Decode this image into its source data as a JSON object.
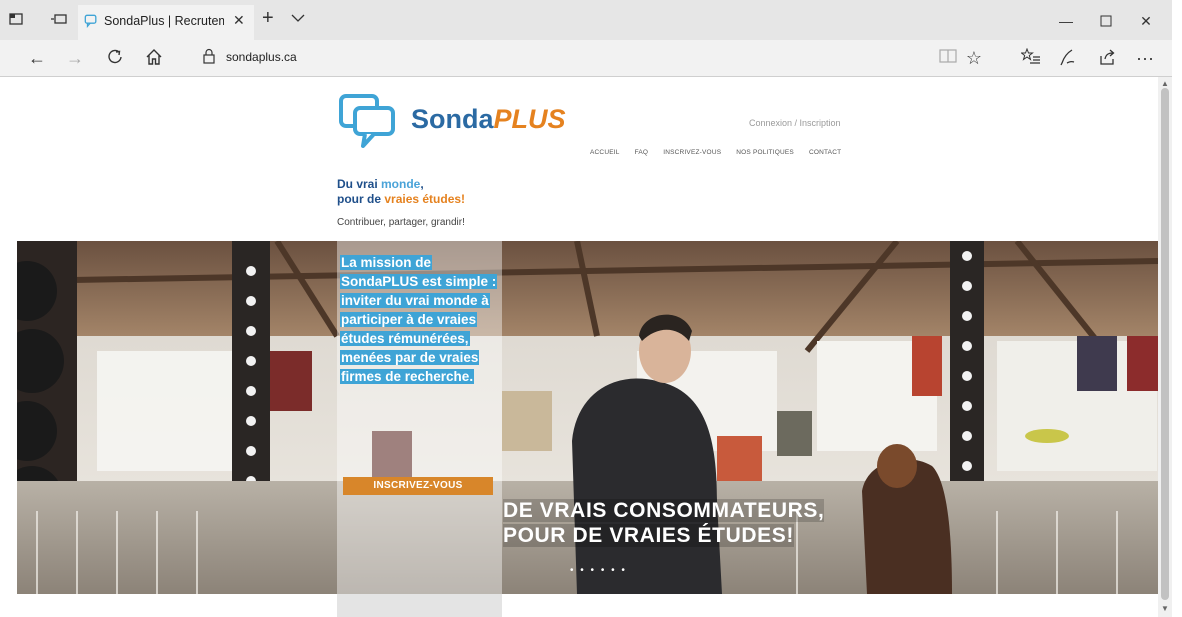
{
  "browser": {
    "tab_title": "SondaPlus | Recrutemer",
    "url": "sondaplus.ca"
  },
  "icons": [
    "tab-actions-icon",
    "tab-preview-icon",
    "tab-favicon",
    "close-icon",
    "new-tab-icon",
    "tab-list-icon",
    "minimize-icon",
    "maximize-icon",
    "close-window-icon",
    "back-icon",
    "forward-icon",
    "refresh-icon",
    "home-icon",
    "lock-icon",
    "reading-view-icon",
    "favorite-star-icon",
    "favorites-hub-icon",
    "pen-icon",
    "share-icon",
    "more-icon",
    "sondaplus-logo-icon"
  ],
  "colors": {
    "brand_blue": "#2b6aa3",
    "brand_orange": "#e5821f",
    "highlight_blue": "#3fa4d6",
    "button_orange": "#d8862a"
  },
  "site": {
    "logo_main": "Sonda",
    "logo_plus": "PLUS",
    "login_link": "Connexion / Inscription",
    "nav": [
      "ACCUEIL",
      "FAQ",
      "INSCRIVEZ-VOUS",
      "NOS POLITIQUES",
      "CONTACT"
    ],
    "tagline_a": "Du vrai ",
    "tagline_b": "monde",
    "tagline_c": ",",
    "tagline_d": "pour de ",
    "tagline_e": "vraies études!",
    "tagline_sub": "Contribuer, partager, grandir!"
  },
  "hero": {
    "mission": "La mission de SondaPLUS est simple : inviter du vrai monde à participer à de vraies études rémunérées, menées par de vraies firmes de recherche.",
    "signup_button": "INSCRIVEZ-VOUS",
    "headline_line1": "DE VRAIS CONSOMMATEURS,",
    "headline_line2": "POUR DE VRAIES ÉTUDES!",
    "dots": "• • • • • •"
  }
}
